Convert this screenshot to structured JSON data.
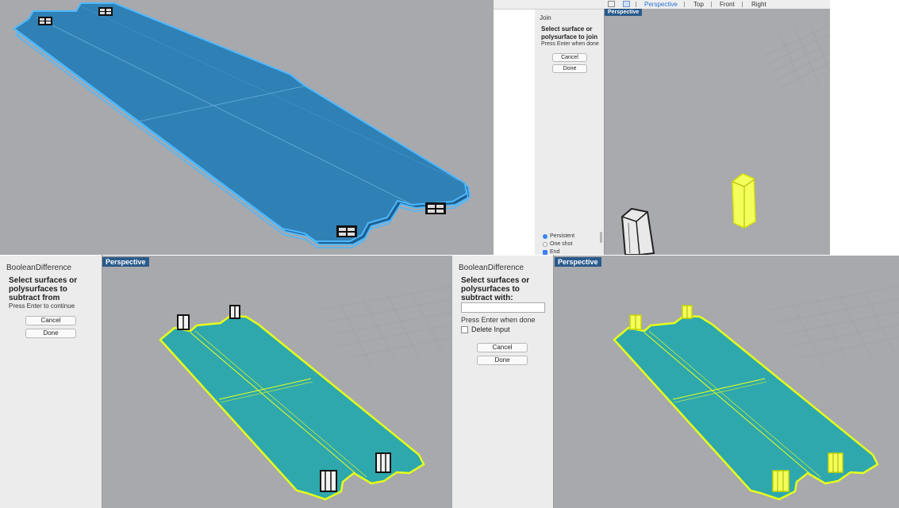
{
  "top_right": {
    "toolbar": {
      "tabs": [
        "Perspective",
        "Top",
        "Front",
        "Right"
      ],
      "active": "Perspective"
    },
    "viewport_label": "Perspective",
    "command": {
      "title": "Join",
      "prompt": "Select surface or polysurface to join",
      "hint": "Press Enter when done",
      "cancel": "Cancel",
      "done": "Done",
      "option_persistent": "Persistent",
      "option_one_shot": "One shot",
      "option_end": "End"
    }
  },
  "bottom_left": {
    "viewport_label": "Perspective",
    "command": {
      "title": "BooleanDifference",
      "prompt": "Select surfaces or polysurfaces to subtract from",
      "hint": "Press Enter to continue",
      "cancel": "Cancel",
      "done": "Done"
    }
  },
  "bottom_right": {
    "viewport_label": "Perspective",
    "command": {
      "title": "BooleanDifference",
      "prompt": "Select surfaces or polysurfaces to subtract with:",
      "input_value": "",
      "hint": "Press Enter when done",
      "delete_input": "Delete Input",
      "cancel": "Cancel",
      "done": "Done"
    }
  },
  "colors": {
    "viewport_bg": "#a7a9ad",
    "plate_blue": "#2f80b5",
    "plate_outline": "#4db8ff",
    "plate_teal": "#2fa8ad",
    "selection_yellow": "#e6ff1a",
    "label_bg": "#2a5a8a"
  }
}
